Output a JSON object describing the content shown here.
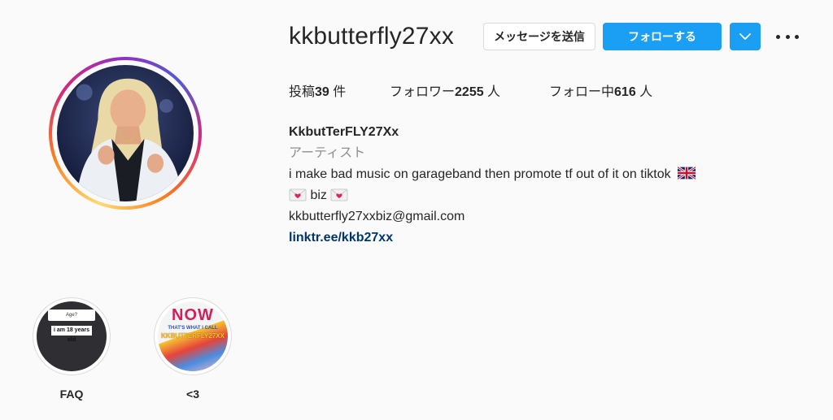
{
  "profile": {
    "username": "kkbutterfly27xx",
    "avatar_icon": "profile-photo",
    "buttons": {
      "message": "メッセージを送信",
      "follow": "フォローする",
      "dropdown_icon": "chevron-down-icon",
      "more_icon": "more-options-icon"
    },
    "stats": [
      {
        "label": "投稿",
        "count": "39",
        "unit": " 件"
      },
      {
        "label": "フォロワー",
        "count": "2255",
        "unit": " 人"
      },
      {
        "label": "フォロー中",
        "count": "616",
        "unit": " 人"
      }
    ],
    "bio": {
      "display_name": "KkbutTerFLY27Xx",
      "category": "アーティスト",
      "line1": "i make bad music on garageband then promote tf out of it on tiktok",
      "line2": " biz ",
      "email": "kkbutterfly27xxbiz@gmail.com",
      "link": "linktr.ee/kkb27xx"
    }
  },
  "highlights": [
    {
      "label": "FAQ",
      "cover_text_top": "Age?",
      "cover_text_main": "i am 18 years old"
    },
    {
      "label": "<3",
      "cover_text_top": "NOW",
      "cover_text_main": "THAT'S WHAT I CALL",
      "cover_text_sub": "KKBUTTERFLY27XX"
    }
  ],
  "colors": {
    "accent_blue": "#1a9ff5",
    "link_blue": "#00376b",
    "muted_gray": "#8e8e8e",
    "border_gray": "#dbdbdb"
  }
}
